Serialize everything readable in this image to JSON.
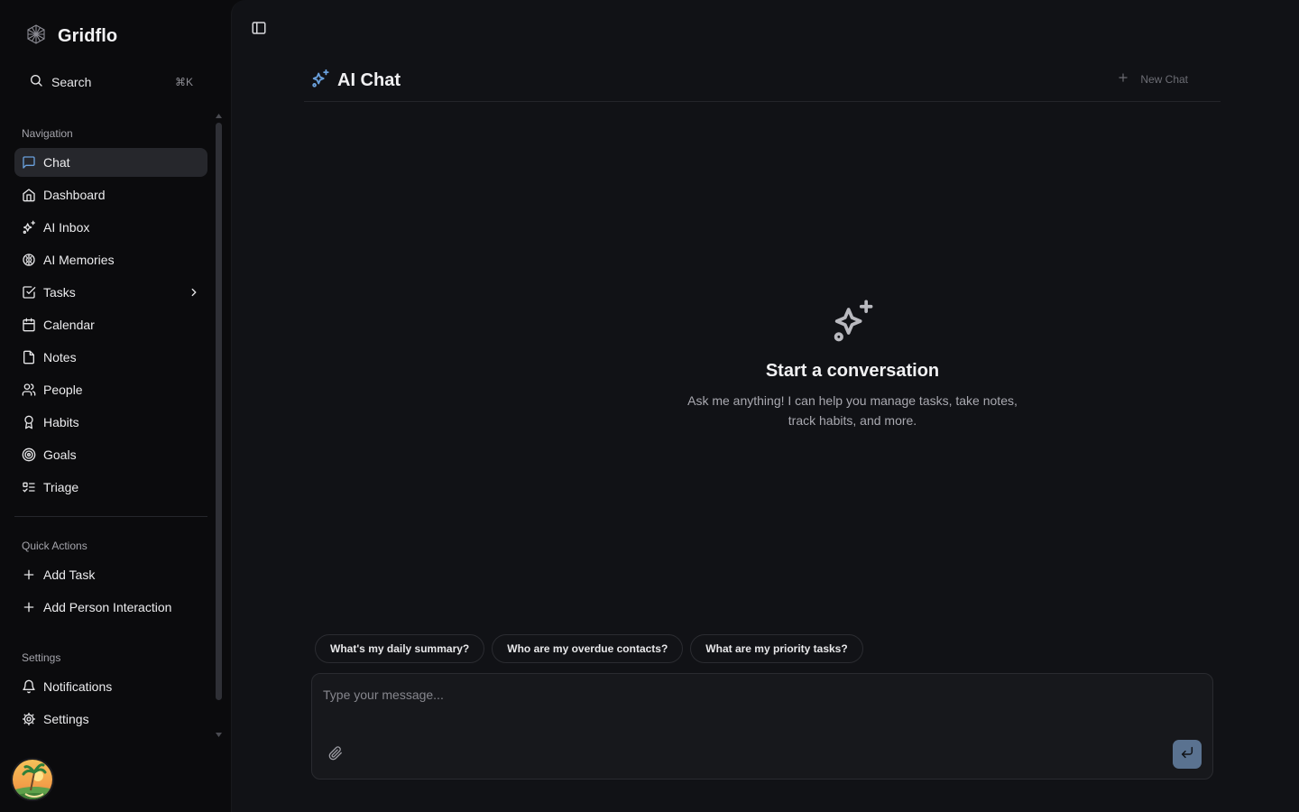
{
  "app": {
    "name": "Gridflo"
  },
  "search": {
    "label": "Search",
    "shortcut": "⌘K"
  },
  "nav": {
    "title": "Navigation",
    "items": [
      {
        "label": "Chat",
        "icon": "message-square-icon",
        "active": true
      },
      {
        "label": "Dashboard",
        "icon": "home-icon"
      },
      {
        "label": "AI Inbox",
        "icon": "sparkles-icon"
      },
      {
        "label": "AI Memories",
        "icon": "brain-icon"
      },
      {
        "label": "Tasks",
        "icon": "check-square-icon",
        "has_children": true
      },
      {
        "label": "Calendar",
        "icon": "calendar-icon"
      },
      {
        "label": "Notes",
        "icon": "file-icon"
      },
      {
        "label": "People",
        "icon": "users-icon"
      },
      {
        "label": "Habits",
        "icon": "award-icon"
      },
      {
        "label": "Goals",
        "icon": "target-icon"
      },
      {
        "label": "Triage",
        "icon": "list-todo-icon"
      }
    ]
  },
  "quick_actions": {
    "title": "Quick Actions",
    "items": [
      {
        "label": "Add Task",
        "icon": "plus-icon"
      },
      {
        "label": "Add Person Interaction",
        "icon": "plus-icon"
      }
    ]
  },
  "settings": {
    "title": "Settings",
    "items": [
      {
        "label": "Notifications",
        "icon": "bell-icon"
      },
      {
        "label": "Settings",
        "icon": "gear-icon"
      }
    ]
  },
  "main": {
    "title": "AI Chat",
    "new_chat": "New Chat",
    "empty": {
      "heading": "Start a conversation",
      "subtitle": "Ask me anything! I can help you manage tasks, take notes, track habits, and more."
    },
    "suggestions": [
      "What's my daily summary?",
      "Who are my overdue contacts?",
      "What are my priority tasks?"
    ],
    "composer": {
      "placeholder": "Type your message..."
    }
  },
  "colors": {
    "accent": "#6aa0dc",
    "send_button": "#5a7290",
    "background": "#0b0b0d",
    "panel": "#111216"
  }
}
